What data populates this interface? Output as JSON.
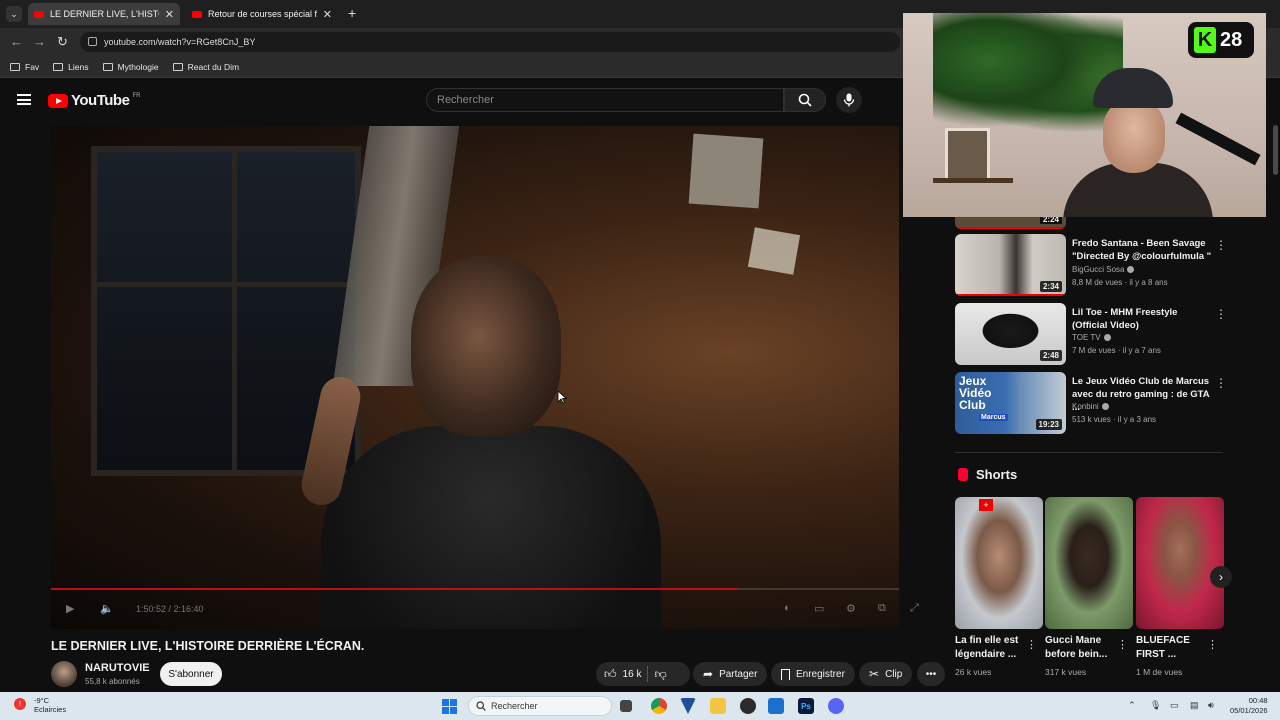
{
  "browser": {
    "tabs": [
      {
        "label": "LE DERNIER LIVE, L'HISTOIRE D",
        "active": true
      },
      {
        "label": "Retour de courses spécial fêtes",
        "active": false
      }
    ],
    "url": "youtube.com/watch?v=RGet8CnJ_BY",
    "bookmarks": [
      "Fav",
      "Liens",
      "Mythologie",
      "React du Dim"
    ]
  },
  "youtube": {
    "logo_text": "YouTube",
    "region": "FR",
    "search_placeholder": "Rechercher"
  },
  "video": {
    "title": "LE DERNIER LIVE, L'HISTOIRE DERRIÈRE L'ÉCRAN.",
    "time_current": "1:50:52",
    "time_total": "2:16:40",
    "timecode": "1:50:52 / 2:16:40",
    "progress": 0.81,
    "channel": "NARUTOVIE",
    "subscribers": "55,8 k abonnés",
    "subscribe_label": "S'abonner",
    "likes": "16 k",
    "share_label": "Partager",
    "save_label": "Enregistrer",
    "clip_label": "Clip"
  },
  "recommendations": [
    {
      "title": "Fredo Santana - Been Savage \"Directed By @colourfulmula \"",
      "channel": "BigGucci Sosa",
      "meta": "8,8 M de vues · il y a 8 ans",
      "duration": "2:34"
    },
    {
      "title": "Lil Toe - MHM Freestyle (Official Video)",
      "channel": "TOE TV",
      "meta": "7 M de vues · il y a 7 ans",
      "duration": "2:48"
    },
    {
      "title": "Le Jeux Vidéo Club de Marcus avec du retro gaming : de GTA ...",
      "channel": "Konbini",
      "meta": "513 k vues · il y a 3 ans",
      "duration": "19:23",
      "thumb_text": "Jeux Vidéo Club",
      "thumb_sub": "Marcus"
    }
  ],
  "partial_duration": "2:24",
  "shorts": {
    "section_title": "Shorts",
    "items": [
      {
        "title": "La fin elle est légendaire ...",
        "views": "26 k vues"
      },
      {
        "title": "Gucci Mane before bein...",
        "views": "317 k vues"
      },
      {
        "title": "BLUEFACE FIRST ...",
        "views": "1 M de vues"
      }
    ]
  },
  "overlay": {
    "viewer_count": "28",
    "badge_letter": "K",
    "brand_color": "#53fc18"
  },
  "taskbar": {
    "weather_temp": "-9°C",
    "weather_desc": "Eclaircies",
    "search_placeholder": "Rechercher",
    "time": "00:48",
    "date": "05/01/2026"
  }
}
